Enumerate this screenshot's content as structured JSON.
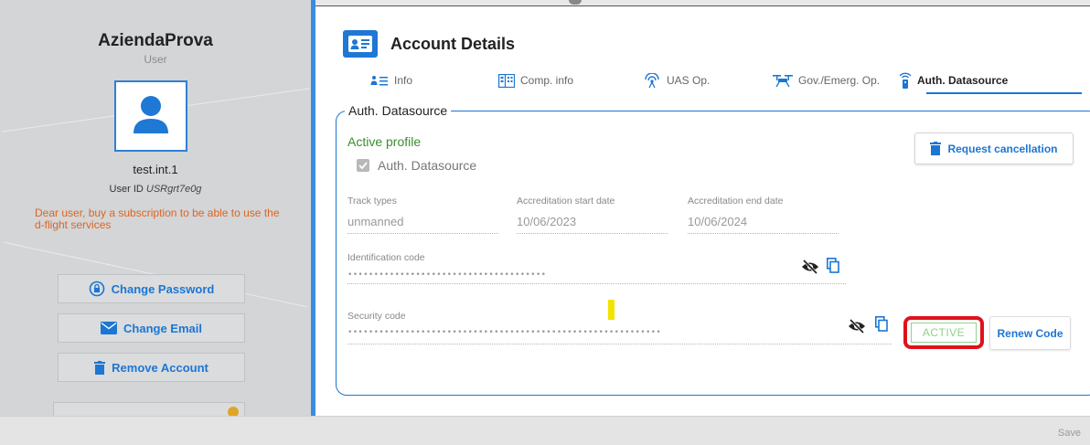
{
  "sidebar": {
    "company": "AziendaProva",
    "role": "User",
    "username": "test.int.1",
    "user_id_label": "User ID",
    "user_id_value": "USRgrt7e0g",
    "warning": "Dear user, buy a subscription to be able to use the d-flight services",
    "buttons": {
      "change_password": "Change Password",
      "change_email": "Change Email",
      "remove_account": "Remove Account"
    }
  },
  "main": {
    "title": "Account Details",
    "tabs": [
      {
        "label": "Info",
        "icon": "info-list-icon"
      },
      {
        "label": "Comp. info",
        "icon": "building-icon"
      },
      {
        "label": "UAS Op.",
        "icon": "antenna-icon"
      },
      {
        "label": "Gov./Emerg. Op.",
        "icon": "drone-icon"
      },
      {
        "label": "Auth. Datasource",
        "icon": "auth-remote-icon"
      }
    ],
    "active_tab": "Auth. Datasource",
    "section": {
      "legend": "Auth. Datasource",
      "active_profile": "Active profile",
      "checkbox_label": "Auth. Datasource",
      "checkbox_checked": true,
      "request_cancellation": "Request cancellation",
      "fields": {
        "track_types": {
          "label": "Track types",
          "value": "unmanned"
        },
        "accr_start": {
          "label": "Accreditation start date",
          "value": "10/06/2023"
        },
        "accr_end": {
          "label": "Accreditation end date",
          "value": "10/06/2024"
        },
        "identification_code": {
          "label": "Identification code",
          "value": "••••••••••••••••••••••••••••••••••••••"
        },
        "security_code": {
          "label": "Security code",
          "value": "••••••••••••••••••••••••••••••••••••••••••••••••••••••••••••"
        }
      },
      "status_badge": "ACTIVE",
      "renew_code": "Renew Code"
    }
  },
  "footer": {
    "save": "Save"
  },
  "colors": {
    "accent": "#1c76d2",
    "active_green": "#3a8e2e",
    "warning_orange": "#e0641f",
    "highlight_red": "#e0111d"
  }
}
